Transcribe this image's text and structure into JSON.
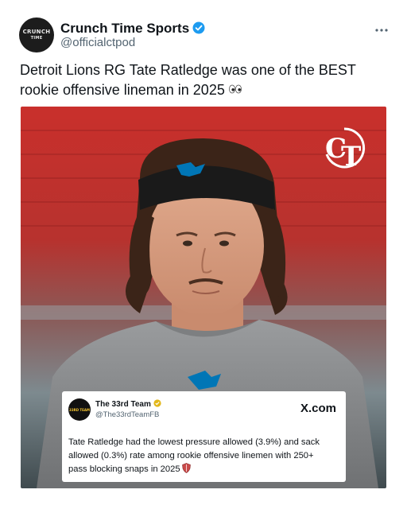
{
  "author": {
    "display_name": "Crunch Time Sports",
    "handle": "@officialctpod",
    "avatar_text_line1": "CRUNCH",
    "avatar_text_line2": "TIME",
    "verified": true
  },
  "post": {
    "text": "Detroit Lions RG Tate Ratledge was one of the BEST rookie offensive lineman in 2025",
    "emoji": "eyes-emoji"
  },
  "media": {
    "logo_text": "CT"
  },
  "quoted_card": {
    "avatar_text": "33RD TEAM",
    "name": "The 33rd Team",
    "handle": "@The33rdTeamFB",
    "brand": "X.com",
    "text": "Tate Ratledge had the lowest pressure allowed (3.9%) and sack allowed (0.3%) rate among rookie offensive linemen with 250+ pass blocking snaps in 2025",
    "emoji": "shield-emoji"
  },
  "colors": {
    "verified": "#1d9bf0",
    "lions_blue": "#0076b6",
    "stadium_red": "#c9302c"
  }
}
